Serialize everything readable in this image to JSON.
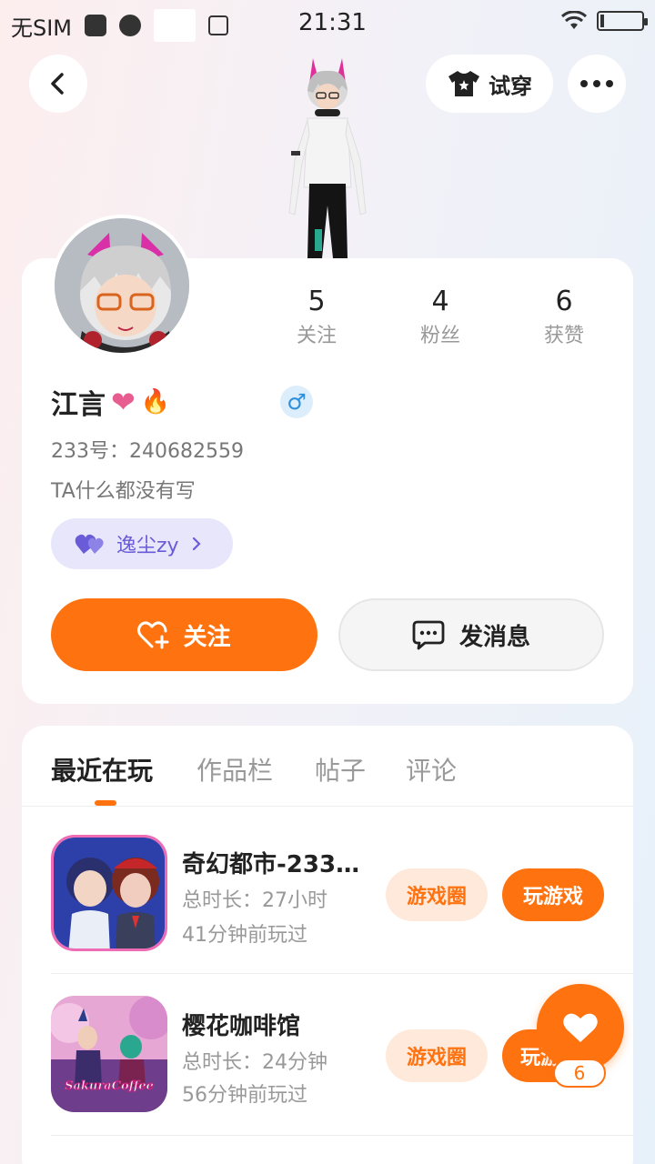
{
  "status_bar": {
    "carrier": "无SIM",
    "time": "21:31"
  },
  "header": {
    "tryon_label": "试穿"
  },
  "profile": {
    "name": "江言",
    "name_emoji_heart": "❤",
    "name_emoji_fire": "🔥",
    "gender_symbol": "♂",
    "uid": "233号：240682559",
    "bio": "TA什么都没有写",
    "cp_name": "逸尘zy",
    "stats": [
      {
        "value": "5",
        "label": "关注"
      },
      {
        "value": "4",
        "label": "粉丝"
      },
      {
        "value": "6",
        "label": "获赞"
      }
    ],
    "follow_label": "关注",
    "message_label": "发消息"
  },
  "tabs": [
    {
      "label": "最近在玩",
      "active": true
    },
    {
      "label": "作品栏",
      "active": false
    },
    {
      "label": "帖子",
      "active": false
    },
    {
      "label": "评论",
      "active": false
    }
  ],
  "games": [
    {
      "name": "奇幻都市-233…",
      "duration": "总时长：27小时",
      "last_played": "41分钟前玩过",
      "circle_label": "游戏圈",
      "play_label": "玩游戏"
    },
    {
      "name": "樱花咖啡馆",
      "icon_text": "SakuraCoffee",
      "duration": "总时长：24分钟",
      "last_played": "56分钟前玩过",
      "circle_label": "游戏圈",
      "play_label": "玩游戏"
    }
  ],
  "floating_like": {
    "count": "6"
  },
  "colors": {
    "accent": "#ff7210",
    "accent_soft": "#ffe9da",
    "cp_bg": "#e8e6fb",
    "cp_text": "#6a5cd8",
    "gender_bg": "#dceefb"
  }
}
